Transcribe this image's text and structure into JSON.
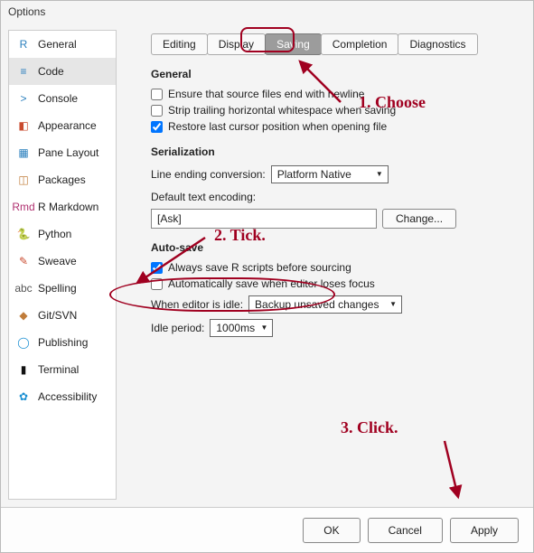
{
  "window": {
    "title": "Options"
  },
  "sidebar": {
    "items": [
      {
        "label": "General",
        "icon_color": "#2a7fbd",
        "glyph": "R"
      },
      {
        "label": "Code",
        "icon_color": "#2a7fbd",
        "glyph": "≡"
      },
      {
        "label": "Console",
        "icon_color": "#2a7fbd",
        "glyph": ">"
      },
      {
        "label": "Appearance",
        "icon_color": "#c94b2f",
        "glyph": "◧"
      },
      {
        "label": "Pane Layout",
        "icon_color": "#2a7fbd",
        "glyph": "▦"
      },
      {
        "label": "Packages",
        "icon_color": "#c07c3a",
        "glyph": "◫"
      },
      {
        "label": "R Markdown",
        "icon_color": "#b03070",
        "glyph": "Rmd"
      },
      {
        "label": "Python",
        "icon_color": "#3572A5",
        "glyph": "🐍"
      },
      {
        "label": "Sweave",
        "icon_color": "#c94b2f",
        "glyph": "✎"
      },
      {
        "label": "Spelling",
        "icon_color": "#555",
        "glyph": "abc"
      },
      {
        "label": "Git/SVN",
        "icon_color": "#c07c3a",
        "glyph": "◆"
      },
      {
        "label": "Publishing",
        "icon_color": "#1a8fd2",
        "glyph": "◯"
      },
      {
        "label": "Terminal",
        "icon_color": "#111",
        "glyph": "▮"
      },
      {
        "label": "Accessibility",
        "icon_color": "#1a8fd2",
        "glyph": "✿"
      }
    ],
    "selected_index": 1
  },
  "tabs": {
    "items": [
      "Editing",
      "Display",
      "Saving",
      "Completion",
      "Diagnostics"
    ],
    "selected_index": 2
  },
  "general": {
    "title": "General",
    "opt1": "Ensure that source files end with newline",
    "opt2": "Strip trailing horizontal whitespace when saving",
    "opt3": "Restore last cursor position when opening file",
    "checked": [
      false,
      false,
      true
    ]
  },
  "serialization": {
    "title": "Serialization",
    "line_ending_label": "Line ending conversion:",
    "line_ending_value": "Platform Native",
    "encoding_label": "Default text encoding:",
    "encoding_value": "[Ask]",
    "change_btn": "Change..."
  },
  "autosave": {
    "title": "Auto-save",
    "opt1": "Always save R scripts before sourcing",
    "opt2": "Automatically save when editor loses focus",
    "idle_label": "When editor is idle:",
    "idle_value": "Backup unsaved changes",
    "period_label": "Idle period:",
    "period_value": "1000ms",
    "checked": [
      true,
      false
    ]
  },
  "footer": {
    "ok": "OK",
    "cancel": "Cancel",
    "apply": "Apply"
  },
  "annotations": {
    "a1": "1. Choose",
    "a2": "2. Tick.",
    "a3": "3. Click."
  }
}
